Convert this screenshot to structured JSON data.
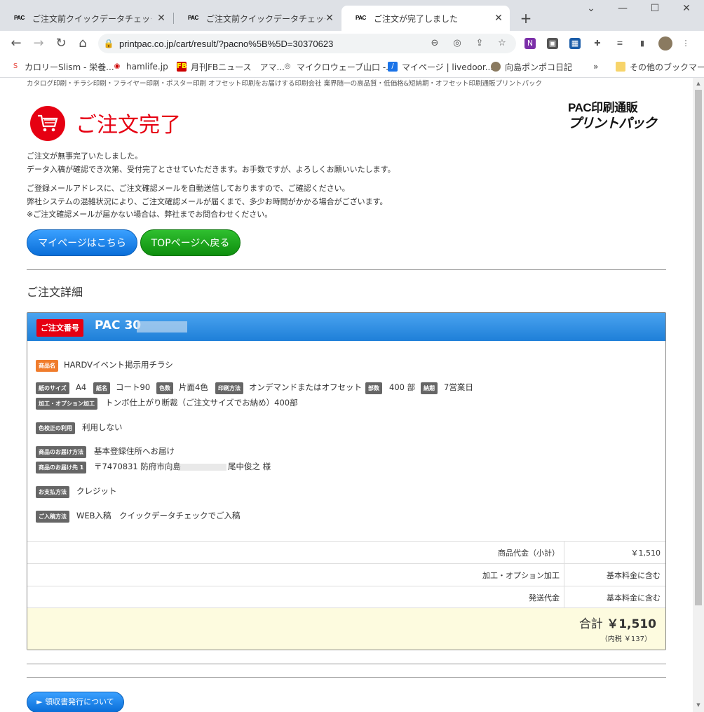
{
  "tabs": [
    {
      "favicon": "PAC",
      "title": "ご注文前クイックデータチェック　サー|"
    },
    {
      "favicon": "PAC",
      "title": "ご注文前クイックデータチェック　サー|"
    },
    {
      "favicon": "PAC",
      "title": "ご注文が完了しました"
    }
  ],
  "address_bar": {
    "url": "printpac.co.jp/cart/result/?pacno%5B%5D=30370623"
  },
  "bookmarks": [
    {
      "label": "カロリーSlism - 栄養...",
      "icon": "slism-icon"
    },
    {
      "label": "hamlife.jp",
      "icon": "hamlife-icon"
    },
    {
      "label": "月刊FBニュース　アマ...",
      "icon": "fb-icon"
    },
    {
      "label": "マイクロウェーブ山口 -...",
      "icon": "microwave-icon"
    },
    {
      "label": "マイページ | livedoor...",
      "icon": "livedoor-icon"
    },
    {
      "label": "向島ポンポコ日記",
      "icon": "ponpoko-icon"
    },
    {
      "label": "その他のブックマーク",
      "icon": "folder-icon"
    }
  ],
  "page": {
    "tagline": "カタログ印刷・チラシ印刷・フライヤー印刷・ポスター印刷 オフセット印刷をお届けする印刷会社 業界随一の高品質・低価格&短納期・オフセット印刷通販プリントパック",
    "title": "ご注文完了",
    "logo_line1": "PAC印刷通販",
    "logo_line2": "プリントパック",
    "msg1": "ご注文が無事完了いたしました。",
    "msg2": "データ入稿が確認でき次第、受付完了とさせていただきます。お手数ですが、よろしくお願いいたします。",
    "msg3": "ご登録メールアドレスに、ご注文確認メールを自動送信しておりますので、ご確認ください。",
    "msg4": "弊社システムの混雑状況により、ご注文確認メールが届くまで、多少お時間がかかる場合がございます。",
    "msg5": "※ご注文確認メールが届かない場合は、弊社までお問合わせください。",
    "mypage_button": "マイページはこちら",
    "top_button": "TOPページへ戻る",
    "details_heading": "ご注文詳細",
    "receipt_button": "► 領収書発行について"
  },
  "order": {
    "number_label": "ご注文番号",
    "number": "PAC 30",
    "product_label": "商品名",
    "product": "HARDVイベント掲示用チラシ",
    "size_label": "紙のサイズ",
    "size": "A4",
    "paper_label": "紙名",
    "paper": "コート90",
    "colors_label": "色数",
    "colors": "片面4色",
    "method_label": "印刷方法",
    "method": "オンデマンドまたはオフセット",
    "copies_label": "部数",
    "copies": "400 部",
    "delivery_label": "納期",
    "delivery": "7営業日",
    "option_label": "加工・オプション加工",
    "option": "トンボ仕上がり断裁（ご注文サイズでお納め）400部",
    "proof_label": "色校正の利用",
    "proof": "利用しない",
    "shipping_method_label": "商品のお届け方法",
    "shipping_method": "基本登録住所へお届け",
    "shipping_to_label": "商品のお届け先 1",
    "shipping_to_a": "〒7470831 防府市向島",
    "shipping_to_b": "尾中俊之 様",
    "payment_label": "お支払方法",
    "payment": "クレジット",
    "submit_label": "ご入稿方法",
    "submit": "WEB入稿　クイックデータチェックでご入稿"
  },
  "prices": [
    {
      "label": "商品代金（小計）",
      "value": "￥1,510"
    },
    {
      "label": "加工・オプション加工",
      "value": "基本料金に含む"
    },
    {
      "label": "発送代金",
      "value": "基本料金に含む"
    }
  ],
  "total": {
    "label": "合計",
    "amount": "￥1,510",
    "tax": "（内税 ￥137）"
  },
  "colors": {
    "accent_red": "#e60012",
    "blue": "#1e7fd8",
    "green": "#0e8e0e"
  }
}
